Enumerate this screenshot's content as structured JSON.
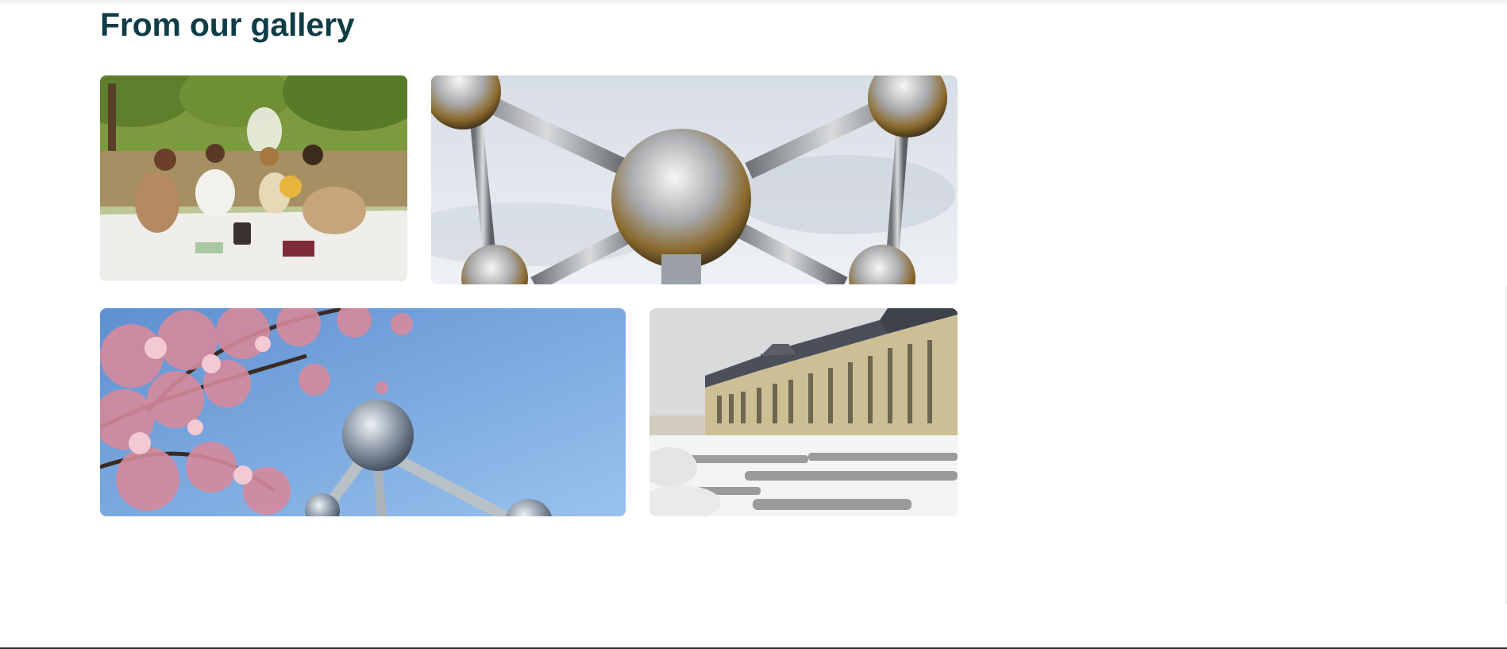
{
  "section": {
    "title": "From our gallery"
  },
  "gallery": {
    "photos": [
      {
        "subject": "friends-picnic-in-park"
      },
      {
        "subject": "atomium-spheres-closeup"
      },
      {
        "subject": "cherry-blossoms-and-atomium"
      },
      {
        "subject": "royal-palace-in-snow"
      }
    ]
  },
  "colors": {
    "title": "#0f3d47",
    "background": "#ffffff"
  }
}
